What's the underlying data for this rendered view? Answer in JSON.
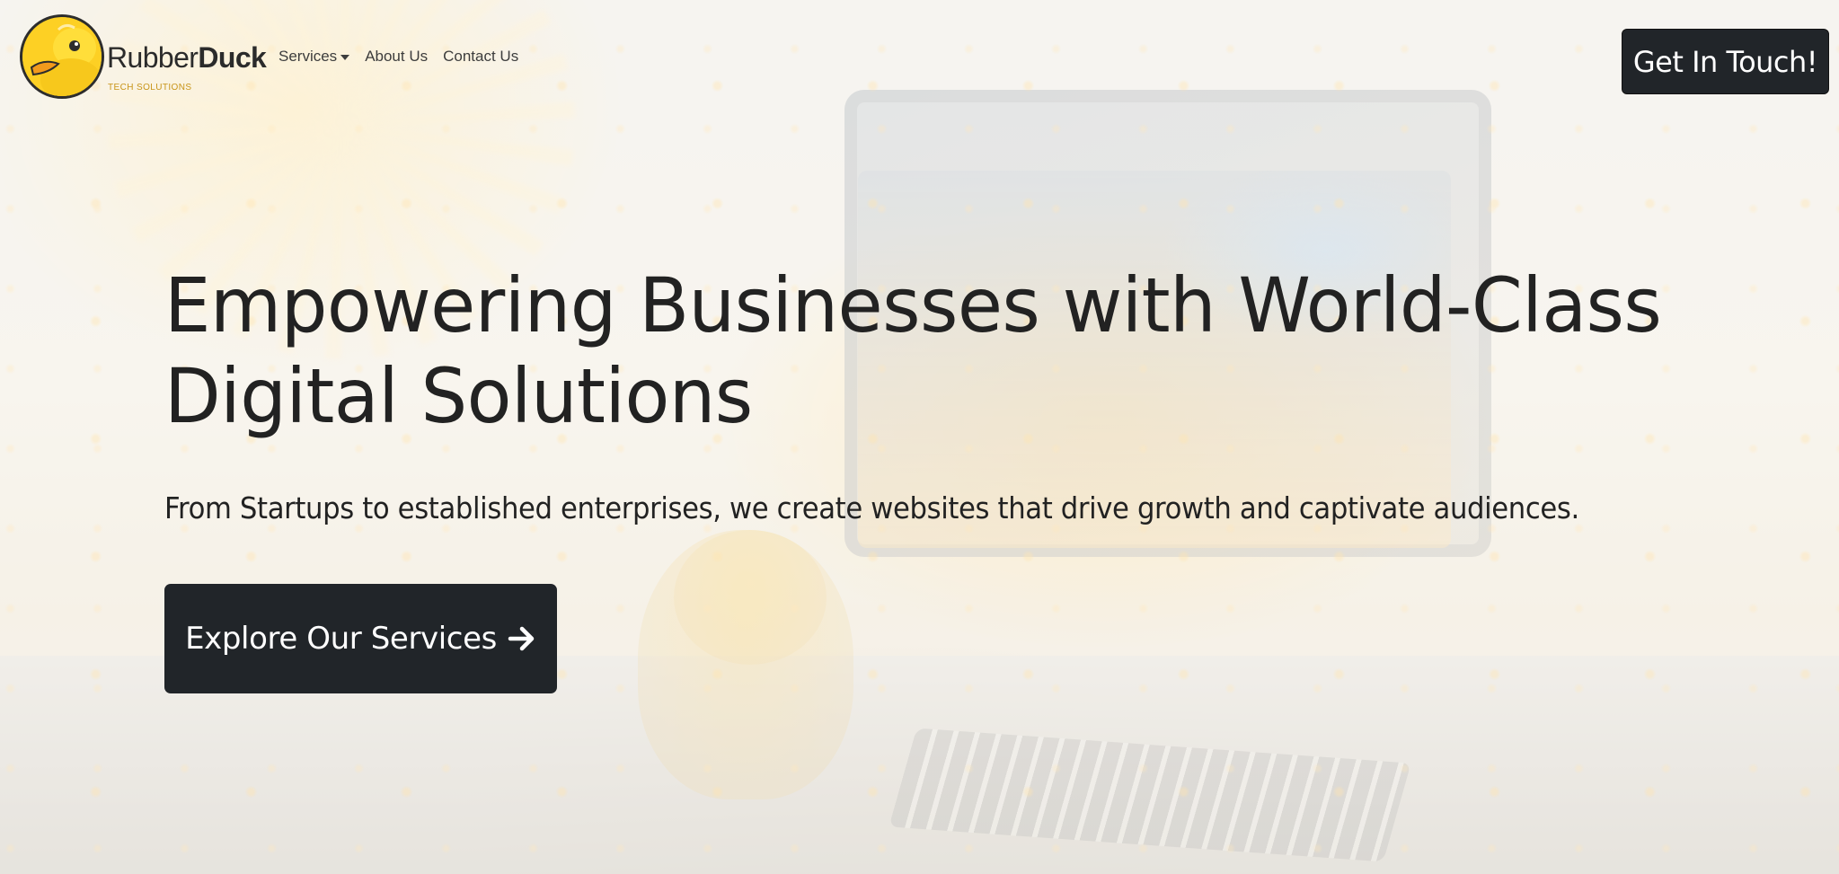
{
  "brand": {
    "name_part1": "Rubber",
    "name_part2": "Duck",
    "tagline": "TECH SOLUTIONS",
    "color": "#fdd024",
    "logo_icon": "rubber-duck-logo"
  },
  "nav": {
    "items": [
      {
        "label": "Services",
        "has_dropdown": true
      },
      {
        "label": "About Us"
      },
      {
        "label": "Contact Us"
      }
    ],
    "cta_label": "Get In Touch!"
  },
  "hero": {
    "title_line1": "Empowering Businesses with World-Class",
    "title_line2": "Digital Solutions",
    "subtitle": "From Startups to established enterprises, we create websites that drive growth and captivate audiences.",
    "cta_label": "Explore Our Services",
    "cta_icon": "arrow-right-icon"
  },
  "colors": {
    "dark_button": "#212529",
    "text": "#222222",
    "accent": "#fdd024"
  }
}
